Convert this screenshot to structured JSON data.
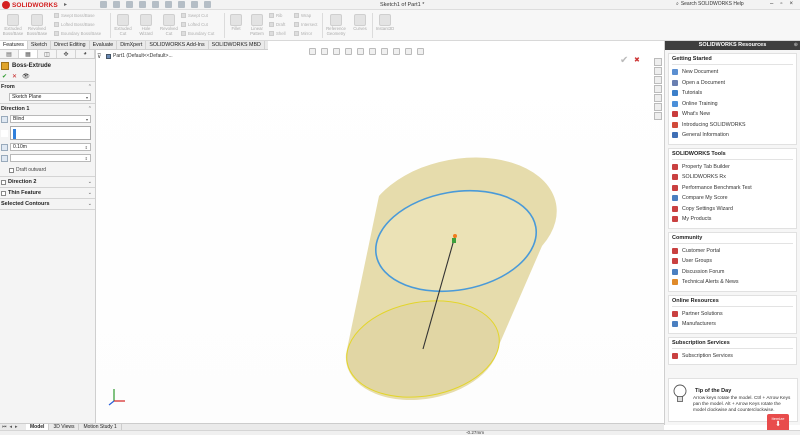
{
  "app": {
    "brand": "SOLIDWORKS",
    "document_title": "Sketch1 of Part1 *",
    "help_search_placeholder": "Search SOLIDWORKS Help"
  },
  "ribbon": {
    "big_tools": [
      {
        "id": "extruded-boss",
        "label": "Extruded\nBoss/Base"
      },
      {
        "id": "revolved-boss",
        "label": "Revolved\nBoss/Base"
      },
      {
        "id": "extruded-cut",
        "label": "Extruded\nCut"
      },
      {
        "id": "hole-wizard",
        "label": "Hole\nWizard"
      },
      {
        "id": "revolved-cut",
        "label": "Revolved\nCut"
      },
      {
        "id": "fillet",
        "label": "Fillet"
      },
      {
        "id": "linear-pattern",
        "label": "Linear\nPattern"
      },
      {
        "id": "reference-geometry",
        "label": "Reference\nGeometry"
      },
      {
        "id": "curves",
        "label": "Curves"
      },
      {
        "id": "instant3d",
        "label": "Instant3D"
      }
    ],
    "small_tools": {
      "swept_boss": "Swept Boss/Base",
      "lofted_boss": "Lofted Boss/Base",
      "boundary_boss": "Boundary Boss/Base",
      "swept_cut": "Swept Cut",
      "lofted_cut": "Lofted Cut",
      "boundary_cut": "Boundary Cut",
      "rib": "Rib",
      "draft": "Draft",
      "shell": "Shell",
      "wrap": "Wrap",
      "intersect": "Intersect",
      "mirror": "Mirror"
    }
  },
  "command_tabs": [
    "Features",
    "Sketch",
    "Direct Editing",
    "Evaluate",
    "DimXpert",
    "SOLIDWORKS Add-Ins",
    "SOLIDWORKS MBD"
  ],
  "property_manager": {
    "feature_name": "Boss-Extrude",
    "from_label": "From",
    "from_value": "Sketch Plane",
    "direction1_label": "Direction 1",
    "end_condition": "Blind",
    "depth_value": "0.10m",
    "draft_outward_label": "Draft outward",
    "direction2_label": "Direction 2",
    "thin_feature_label": "Thin Feature",
    "selected_contours_label": "Selected Contours"
  },
  "graphics": {
    "tree_root": "Part1  (Default<<Default>..."
  },
  "resources": {
    "title": "SOLIDWORKS Resources",
    "sections": [
      {
        "title": "Getting Started",
        "items": [
          {
            "label": "New Document",
            "color": "#5b8fd1"
          },
          {
            "label": "Open a Document",
            "color": "#6a7fb0"
          },
          {
            "label": "Tutorials",
            "color": "#3c7fc9"
          },
          {
            "label": "Online Training",
            "color": "#4a8fd9"
          },
          {
            "label": "What's New",
            "color": "#c93c3c"
          },
          {
            "label": "Introducing SOLIDWORKS",
            "color": "#d14a3a"
          },
          {
            "label": "General Information",
            "color": "#3f6fb5"
          }
        ]
      },
      {
        "title": "SOLIDWORKS Tools",
        "items": [
          {
            "label": "Property Tab Builder",
            "color": "#c94040"
          },
          {
            "label": "SOLIDWORKS Rx",
            "color": "#c94040"
          },
          {
            "label": "Performance Benchmark Test",
            "color": "#c94040"
          },
          {
            "label": "Compare My Score",
            "color": "#4a7fc0"
          },
          {
            "label": "Copy Settings Wizard",
            "color": "#c94040"
          },
          {
            "label": "My Products",
            "color": "#c94040"
          }
        ]
      },
      {
        "title": "Community",
        "items": [
          {
            "label": "Customer Portal",
            "color": "#c94040"
          },
          {
            "label": "User Groups",
            "color": "#c94040"
          },
          {
            "label": "Discussion Forum",
            "color": "#4a7fc0"
          },
          {
            "label": "Technical Alerts & News",
            "color": "#e08a2a"
          }
        ]
      },
      {
        "title": "Online Resources",
        "items": [
          {
            "label": "Partner Solutions",
            "color": "#c94040"
          },
          {
            "label": "Manufacturers",
            "color": "#4a7fc0"
          }
        ]
      },
      {
        "title": "Subscription Services",
        "items": [
          {
            "label": "Subscription Services",
            "color": "#c94040"
          }
        ]
      }
    ],
    "tip_title": "Tip of the Day",
    "tip_text": "Arrow keys rotate the model. Ctrl + Arrow Keys pan the model. Alt + Arrow Keys rotate the model clockwise and counterclockwise.",
    "badge": "Itemize"
  },
  "bottom_tabs": [
    "Model",
    "3D Views",
    "Motion Study 1"
  ],
  "status": {
    "value": "-0.27mm"
  },
  "colors": {
    "cylinder_fill": "#e6dcac",
    "top_edge": "#4a9ad8",
    "bottom_edge": "#e3d52a",
    "brand_red": "#d42020"
  }
}
